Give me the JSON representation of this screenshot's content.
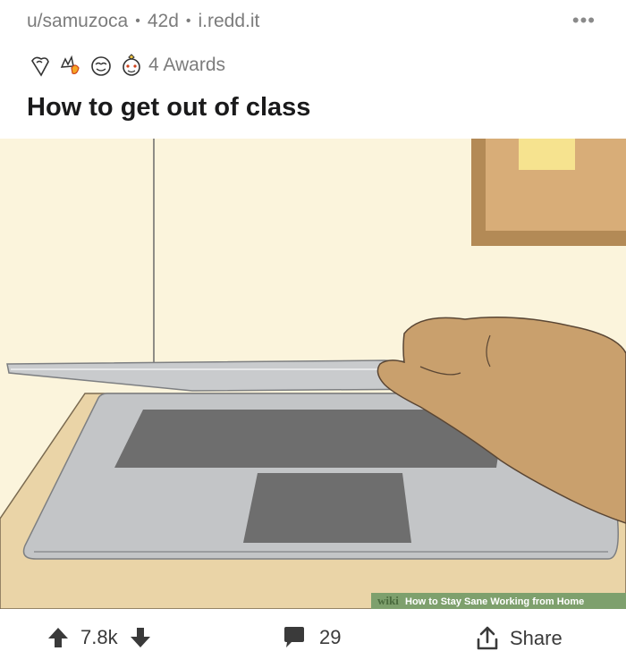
{
  "post": {
    "author": "u/samuzoca",
    "age": "42d",
    "domain": "i.redd.it",
    "separator": "•",
    "more_label": "•••",
    "awards_label": "4 Awards",
    "title": "How to get out of class",
    "image_watermark": {
      "brand": "wiki",
      "text": "How to Stay Sane Working from Home"
    }
  },
  "actions": {
    "upvotes": "7.8k",
    "comments": "29",
    "share_label": "Share"
  },
  "colors": {
    "meta_text": "#7c7c7c",
    "title_text": "#1a1a1b",
    "image_bg": "#fbf4dc",
    "desk": "#e9d3a6",
    "skin": "#c9a06d",
    "watermark_bg": "#7ea06d"
  },
  "icons": [
    "upvote-arrow-icon",
    "downvote-arrow-icon",
    "comment-bubble-icon",
    "share-upload-icon",
    "more-dots-icon"
  ]
}
